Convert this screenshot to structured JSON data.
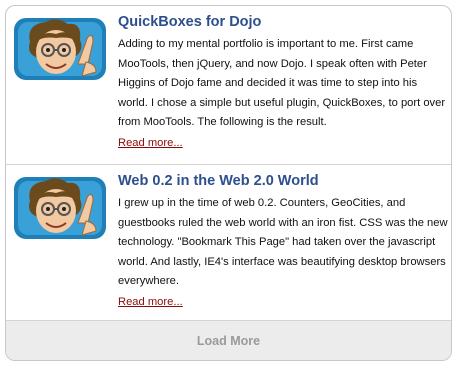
{
  "posts": [
    {
      "title": "QuickBoxes for Dojo",
      "body": "Adding to my mental portfolio is important to me. First came MooTools, then jQuery, and now Dojo. I speak often with Peter Higgins of Dojo fame and decided it was time to step into his world. I chose a simple but useful plugin, QuickBoxes, to port over from MooTools. The following is the result.",
      "read_more": "Read more..."
    },
    {
      "title": "Web 0.2 in the Web 2.0 World",
      "body": "I grew up in the time of web 0.2. Counters, GeoCities, and guestbooks ruled the web world with an iron fist. CSS was the new technology. \"Bookmark This Page\" had taken over the javascript world. And lastly, IE4's interface was beautifying desktop browsers everywhere.",
      "read_more": "Read more..."
    }
  ],
  "load_more": "Load More"
}
